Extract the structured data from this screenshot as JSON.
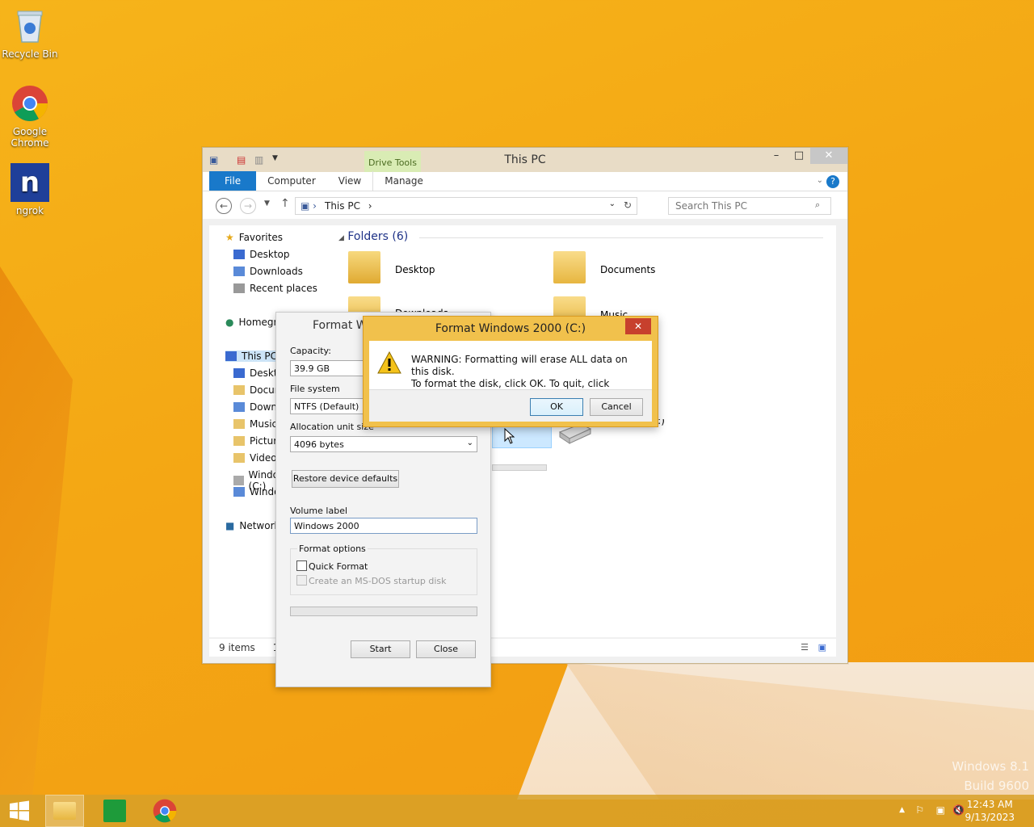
{
  "desktop": {
    "icons": [
      {
        "label": "Recycle Bin"
      },
      {
        "label": "Google Chrome"
      },
      {
        "label": "ngrok"
      }
    ],
    "watermark_line1": "Windows 8.1",
    "watermark_line2": "Build 9600"
  },
  "explorer": {
    "title": "This PC",
    "contextual_tab": "Drive Tools",
    "ribbon_tabs": [
      "File",
      "Computer",
      "View",
      "Manage"
    ],
    "address": "This PC",
    "search_placeholder": "Search This PC",
    "nav": {
      "favorites": "Favorites",
      "fav_items": [
        "Desktop",
        "Downloads",
        "Recent places"
      ],
      "homegroup": "Homegroup",
      "thispc": "This PC",
      "pc_items": [
        "Desktop",
        "Documents",
        "Downloads",
        "Music",
        "Pictures",
        "Videos",
        "Windows 2000 (C:)",
        "Windows 2000"
      ],
      "network": "Network"
    },
    "folders_header": "Folders (6)",
    "folders": [
      "Desktop",
      "Documents",
      "Downloads",
      "Music"
    ],
    "cd_drive": "CD Drive (D:)",
    "status_items": "9 items",
    "status_selected": "1"
  },
  "format_dialog": {
    "title": "Format Windows 2000 (C:)",
    "capacity_label": "Capacity:",
    "capacity_value": "39.9 GB",
    "filesystem_label": "File system",
    "filesystem_value": "NTFS (Default)",
    "alloc_label": "Allocation unit size",
    "alloc_value": "4096 bytes",
    "restore_btn": "Restore device defaults",
    "volume_label": "Volume label",
    "volume_value": "Windows 2000",
    "options_label": "Format options",
    "quick_format": "Quick Format",
    "msdos": "Create an MS-DOS startup disk",
    "start_btn": "Start",
    "close_btn": "Close"
  },
  "confirm": {
    "title": "Format Windows 2000 (C:)",
    "message_line1": "WARNING: Formatting will erase ALL data on this disk.",
    "message_line2": "To format the disk, click OK. To quit, click CANCEL.",
    "ok": "OK",
    "cancel": "Cancel"
  },
  "taskbar": {
    "time": "12:43 AM",
    "date": "9/13/2023"
  }
}
